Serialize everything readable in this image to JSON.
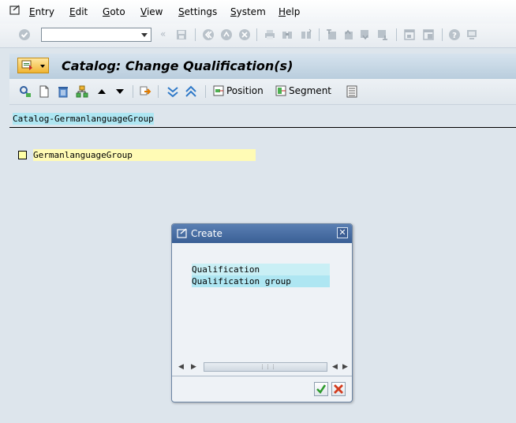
{
  "menubar": {
    "items": [
      "Entry",
      "Edit",
      "Goto",
      "View",
      "Settings",
      "System",
      "Help"
    ]
  },
  "system_toolbar": {
    "command_field_value": "",
    "icons": [
      "enter-icon",
      "back-icon",
      "save-icon",
      "back-nav-icon",
      "exit-icon",
      "cancel-icon",
      "print-icon",
      "find-icon",
      "find-next-icon",
      "first-page-icon",
      "prev-page-icon",
      "next-page-icon",
      "last-page-icon",
      "new-session-icon",
      "shortcut-icon",
      "help-icon",
      "layout-icon"
    ]
  },
  "title_bar": {
    "title": "Catalog: Change Qualification(s)"
  },
  "app_toolbar": {
    "icons": [
      "display-icon",
      "create-icon",
      "delete-icon",
      "structure-icon",
      "up-icon",
      "down-icon",
      "reassign-icon",
      "expand-icon",
      "collapse-icon"
    ],
    "position_label": "Position",
    "segment_label": "Segment"
  },
  "content": {
    "header": "Catalog-GermanlanguageGroup",
    "tree_items": [
      {
        "label": "GermanlanguageGroup"
      }
    ]
  },
  "dialog": {
    "title": "Create",
    "options": [
      "Qualification",
      "Qualification group"
    ]
  },
  "colors": {
    "title_bar": "#c2d5e6",
    "highlight": "#aee6f2",
    "tree_item_bg": "#fffbb5",
    "dialog_header": "#4a6fa5"
  }
}
